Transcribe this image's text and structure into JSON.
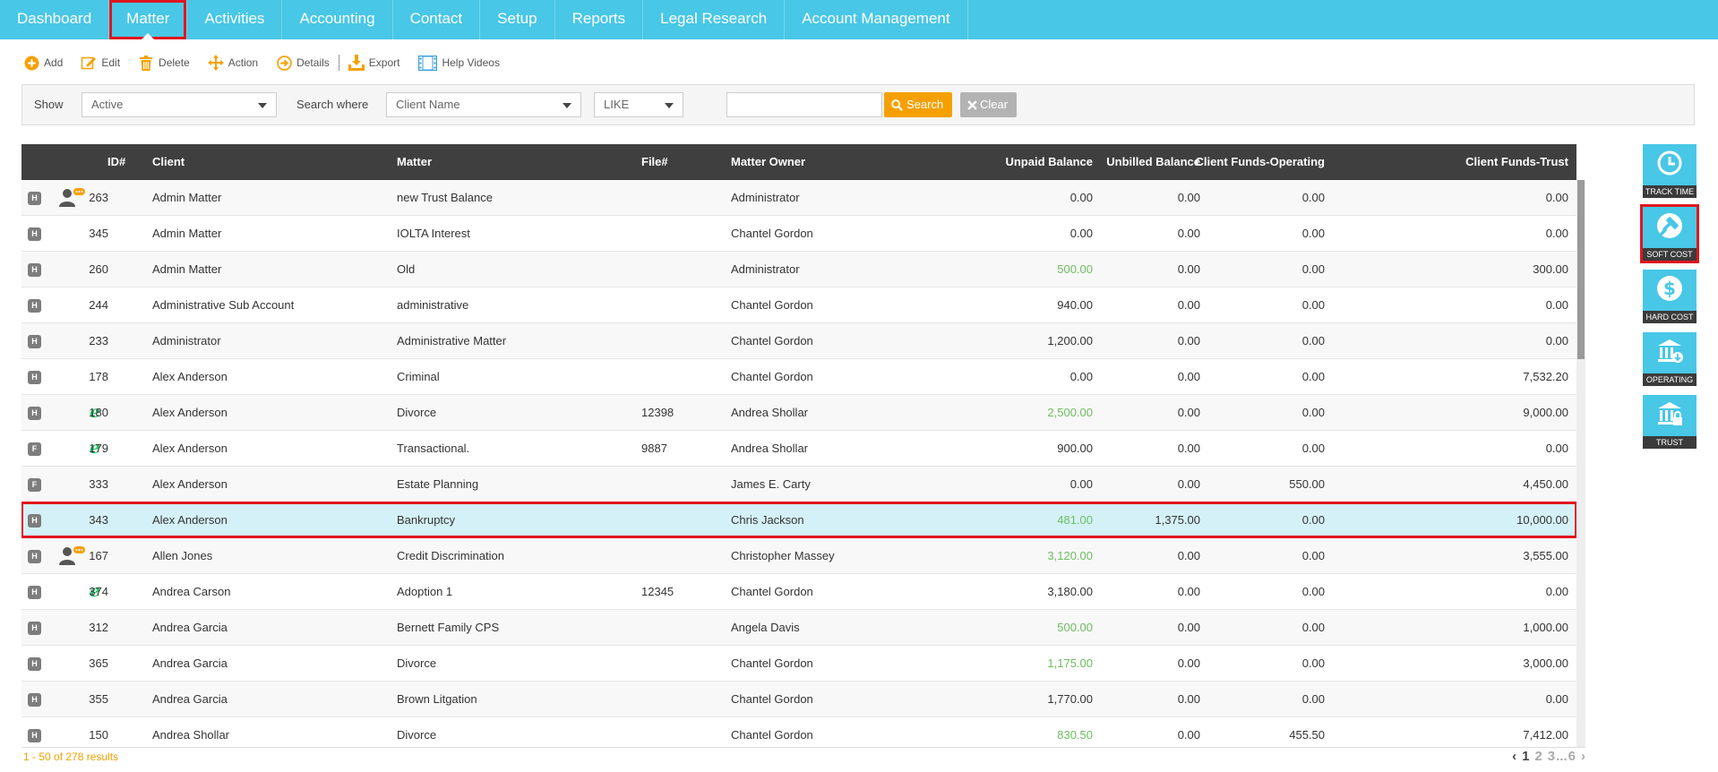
{
  "nav": {
    "tabs": [
      "Dashboard",
      "Matter",
      "Activities",
      "Accounting",
      "Contact",
      "Setup",
      "Reports",
      "Legal Research",
      "Account Management"
    ],
    "active": "Matter"
  },
  "toolbar": {
    "add": "Add",
    "edit": "Edit",
    "delete": "Delete",
    "action": "Action",
    "details": "Details",
    "export": "Export",
    "help": "Help Videos"
  },
  "filter": {
    "show_label": "Show",
    "show_value": "Active",
    "search_where_label": "Search where",
    "field_value": "Client Name",
    "operator_value": "LIKE",
    "search_text": "",
    "search_btn": "Search",
    "clear_btn": "Clear"
  },
  "table": {
    "headers": {
      "id": "ID#",
      "client": "Client",
      "matter": "Matter",
      "file": "File#",
      "owner": "Matter Owner",
      "unpaid": "Unpaid Balance",
      "unbilled": "Unbilled Balance",
      "operating": "Client Funds-Operating",
      "trust": "Client Funds-Trust"
    },
    "rows": [
      {
        "badge": "H",
        "icon": "user",
        "id": "263",
        "client": "Admin Matter",
        "matter": "new Trust Balance",
        "file": "",
        "owner": "Administrator",
        "unpaid": "0.00",
        "unpaid_green": false,
        "unbilled": "0.00",
        "operating": "0.00",
        "trust": "0.00"
      },
      {
        "badge": "H",
        "icon": "",
        "id": "345",
        "client": "Admin Matter",
        "matter": "IOLTA Interest",
        "file": "",
        "owner": "Chantel Gordon",
        "unpaid": "0.00",
        "unpaid_green": false,
        "unbilled": "0.00",
        "operating": "0.00",
        "trust": "0.00"
      },
      {
        "badge": "H",
        "icon": "",
        "id": "260",
        "client": "Admin Matter",
        "matter": "Old",
        "file": "",
        "owner": "Administrator",
        "unpaid": "500.00",
        "unpaid_green": true,
        "unbilled": "0.00",
        "operating": "0.00",
        "trust": "300.00"
      },
      {
        "badge": "H",
        "icon": "",
        "id": "244",
        "client": "Administrative Sub Account",
        "matter": "administrative",
        "file": "",
        "owner": "Chantel Gordon",
        "unpaid": "940.00",
        "unpaid_green": false,
        "unbilled": "0.00",
        "operating": "0.00",
        "trust": "0.00"
      },
      {
        "badge": "H",
        "icon": "",
        "id": "233",
        "client": "Administrator",
        "matter": "Administrative Matter",
        "file": "",
        "owner": "Chantel Gordon",
        "unpaid": "1,200.00",
        "unpaid_green": false,
        "unbilled": "0.00",
        "operating": "0.00",
        "trust": "0.00"
      },
      {
        "badge": "H",
        "icon": "",
        "id": "178",
        "client": "Alex Anderson",
        "matter": "Criminal",
        "file": "",
        "owner": "Chantel Gordon",
        "unpaid": "0.00",
        "unpaid_green": false,
        "unbilled": "0.00",
        "operating": "0.00",
        "trust": "7,532.20"
      },
      {
        "badge": "H",
        "icon": "e",
        "id": "180",
        "client": "Alex Anderson",
        "matter": "Divorce",
        "file": "12398",
        "owner": "Andrea Shollar",
        "unpaid": "2,500.00",
        "unpaid_green": true,
        "unbilled": "0.00",
        "operating": "0.00",
        "trust": "9,000.00"
      },
      {
        "badge": "F",
        "icon": "e",
        "id": "179",
        "client": "Alex Anderson",
        "matter": "Transactional.",
        "file": "9887",
        "owner": "Andrea Shollar",
        "unpaid": "900.00",
        "unpaid_green": false,
        "unbilled": "0.00",
        "operating": "0.00",
        "trust": "0.00"
      },
      {
        "badge": "F",
        "icon": "",
        "id": "333",
        "client": "Alex Anderson",
        "matter": "Estate Planning",
        "file": "",
        "owner": "James E. Carty",
        "unpaid": "0.00",
        "unpaid_green": false,
        "unbilled": "0.00",
        "operating": "550.00",
        "trust": "4,450.00"
      },
      {
        "badge": "H",
        "icon": "",
        "id": "343",
        "client": "Alex Anderson",
        "matter": "Bankruptcy",
        "file": "",
        "owner": "Chris Jackson",
        "unpaid": "481.00",
        "unpaid_green": true,
        "unbilled": "1,375.00",
        "operating": "0.00",
        "trust": "10,000.00",
        "selected": true
      },
      {
        "badge": "H",
        "icon": "user",
        "id": "167",
        "client": "Allen Jones",
        "matter": "Credit Discrimination",
        "file": "",
        "owner": "Christopher Massey",
        "unpaid": "3,120.00",
        "unpaid_green": true,
        "unbilled": "0.00",
        "operating": "0.00",
        "trust": "3,555.00"
      },
      {
        "badge": "H",
        "icon": "e",
        "id": "374",
        "client": "Andrea Carson",
        "matter": "Adoption 1",
        "file": "12345",
        "owner": "Chantel Gordon",
        "unpaid": "3,180.00",
        "unpaid_green": false,
        "unbilled": "0.00",
        "operating": "0.00",
        "trust": "0.00"
      },
      {
        "badge": "H",
        "icon": "",
        "id": "312",
        "client": "Andrea Garcia",
        "matter": "Bernett Family CPS",
        "file": "",
        "owner": "Angela Davis",
        "unpaid": "500.00",
        "unpaid_green": true,
        "unbilled": "0.00",
        "operating": "0.00",
        "trust": "1,000.00"
      },
      {
        "badge": "H",
        "icon": "",
        "id": "365",
        "client": "Andrea Garcia",
        "matter": "Divorce",
        "file": "",
        "owner": "Chantel Gordon",
        "unpaid": "1,175.00",
        "unpaid_green": true,
        "unbilled": "0.00",
        "operating": "0.00",
        "trust": "3,000.00"
      },
      {
        "badge": "H",
        "icon": "",
        "id": "355",
        "client": "Andrea Garcia",
        "matter": "Brown Litgation",
        "file": "",
        "owner": "Chantel Gordon",
        "unpaid": "1,770.00",
        "unpaid_green": false,
        "unbilled": "0.00",
        "operating": "0.00",
        "trust": "0.00"
      },
      {
        "badge": "H",
        "icon": "",
        "id": "150",
        "client": "Andrea Shollar",
        "matter": "Divorce",
        "file": "",
        "owner": "Chantel Gordon",
        "unpaid": "830.50",
        "unpaid_green": true,
        "unbilled": "0.00",
        "operating": "455.50",
        "trust": "7,412.00"
      }
    ]
  },
  "footer": {
    "results": "1 - 50 of 278 results",
    "pages": [
      "1",
      "2",
      "3",
      "...",
      "6"
    ]
  },
  "quick_buttons": [
    {
      "label": "TRACK TIME",
      "icon": "clock-icon"
    },
    {
      "label": "SOFT COST",
      "icon": "gavel-icon",
      "highlighted": true
    },
    {
      "label": "HARD COST",
      "icon": "dollar-icon"
    },
    {
      "label": "OPERATING",
      "icon": "bank-icon"
    },
    {
      "label": "TRUST",
      "icon": "bank-lock-icon"
    }
  ],
  "colors": {
    "nav_bg": "#48c7e6",
    "header_bg": "#3f3f3f",
    "highlight": "#e0161d",
    "positive": "#6cbd5f",
    "accent": "#f6a000"
  }
}
